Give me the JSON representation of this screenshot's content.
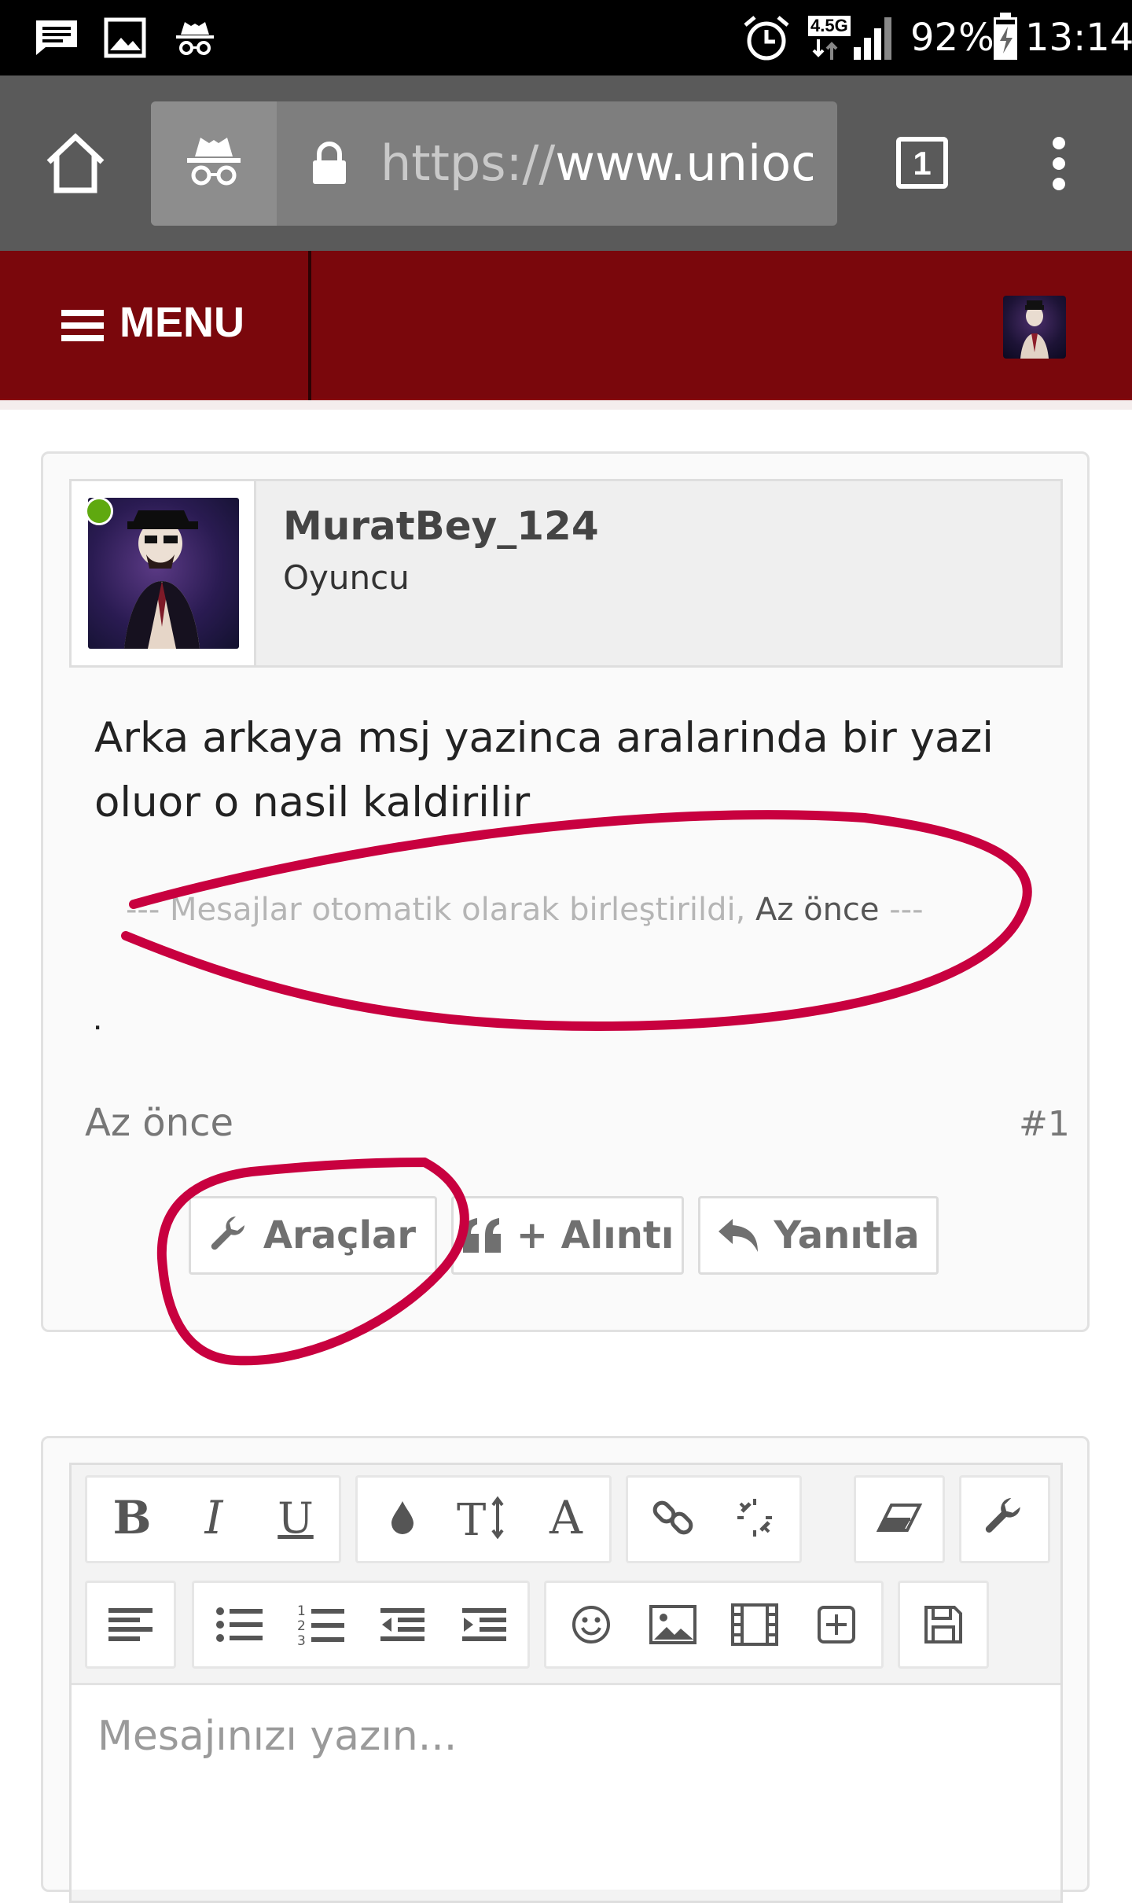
{
  "status_bar": {
    "network": "4.5G",
    "battery": "92%",
    "time": "13:14",
    "icons": [
      "message-icon",
      "image-icon",
      "incognito-icon",
      "alarm-icon",
      "signal-icon",
      "battery-charging-icon"
    ]
  },
  "browser": {
    "url_scheme": "https://",
    "url_host": "www.uniocra",
    "tab_count": "1",
    "icons": [
      "home-icon",
      "incognito-icon",
      "lock-icon",
      "more-vert-icon"
    ]
  },
  "site_nav": {
    "menu_label": "MENU",
    "colors": {
      "bar": "#7a070c",
      "divider": "#2d0204"
    }
  },
  "post": {
    "username": "MuratBey_124",
    "user_title": "Oyuncu",
    "online": true,
    "message": "Arka arkaya msj yazinca aralarinda bir yazi oluor o nasil kaldirilir",
    "merge_prefix": "--- Mesajlar otomatik olarak birleştirildi,",
    "merge_time": "Az önce",
    "merge_suffix": "---",
    "second_message": ".",
    "time": "Az önce",
    "number": "#1",
    "buttons": {
      "tools": "Araçlar",
      "quote": "+ Alıntı",
      "reply": "Yanıtla"
    }
  },
  "editor": {
    "placeholder": "Mesajınızı yazın...",
    "toolbar_row1": [
      "bold-icon",
      "italic-icon",
      "underline-icon",
      "color-icon",
      "font-size-icon",
      "font-family-icon",
      "link-icon",
      "unlink-icon",
      "eraser-icon",
      "tools-icon"
    ],
    "toolbar_row2": [
      "align-left-icon",
      "bullet-list-icon",
      "numbered-list-icon",
      "outdent-icon",
      "indent-icon",
      "smiley-icon",
      "image-icon",
      "media-icon",
      "insert-icon",
      "save-draft-icon"
    ]
  },
  "annotation_color": "#c8003f"
}
